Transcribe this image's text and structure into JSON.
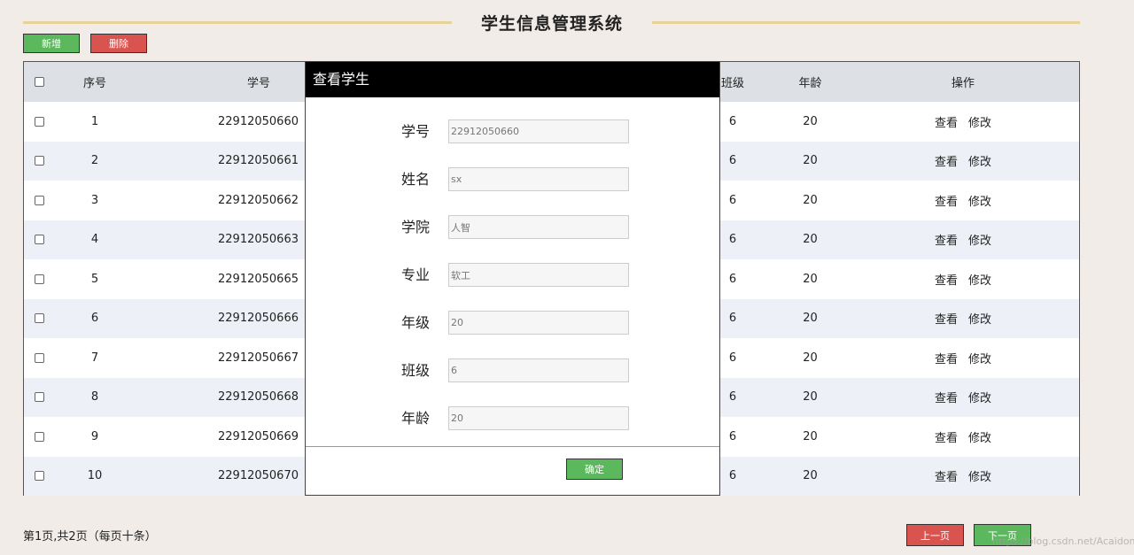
{
  "header": {
    "title": "学生信息管理系统"
  },
  "toolbar": {
    "add_label": "新增",
    "delete_label": "删除"
  },
  "table": {
    "columns": {
      "no": "序号",
      "student_id": "学号",
      "class": "班级",
      "age": "年龄",
      "ops": "操作"
    },
    "rows": [
      {
        "no": "1",
        "student_id": "22912050660",
        "class": "6",
        "age": "20"
      },
      {
        "no": "2",
        "student_id": "22912050661",
        "class": "6",
        "age": "20"
      },
      {
        "no": "3",
        "student_id": "22912050662",
        "class": "6",
        "age": "20"
      },
      {
        "no": "4",
        "student_id": "22912050663",
        "class": "6",
        "age": "20"
      },
      {
        "no": "5",
        "student_id": "22912050665",
        "class": "6",
        "age": "20"
      },
      {
        "no": "6",
        "student_id": "22912050666",
        "class": "6",
        "age": "20"
      },
      {
        "no": "7",
        "student_id": "22912050667",
        "class": "6",
        "age": "20"
      },
      {
        "no": "8",
        "student_id": "22912050668",
        "class": "6",
        "age": "20"
      },
      {
        "no": "9",
        "student_id": "22912050669",
        "class": "6",
        "age": "20"
      },
      {
        "no": "10",
        "student_id": "22912050670",
        "class": "6",
        "age": "20"
      }
    ],
    "view_label": "查看",
    "edit_label": "修改"
  },
  "modal": {
    "title": "查看学生",
    "fields": [
      {
        "label": "学号",
        "value": "22912050660"
      },
      {
        "label": "姓名",
        "value": "sx"
      },
      {
        "label": "学院",
        "value": "人智"
      },
      {
        "label": "专业",
        "value": "软工"
      },
      {
        "label": "年级",
        "value": "20"
      },
      {
        "label": "班级",
        "value": "6"
      },
      {
        "label": "年龄",
        "value": "20"
      }
    ],
    "confirm_label": "确定"
  },
  "pager": {
    "info": "第1页,共2页（每页十条）",
    "prev_label": "上一页",
    "next_label": "下一页"
  },
  "watermark": "https://blog.csdn.net/Acaidong",
  "colors": {
    "green": "#5cb85c",
    "red": "#d9534f",
    "header_line": "#e7d39a",
    "modal_header": "#000000"
  }
}
